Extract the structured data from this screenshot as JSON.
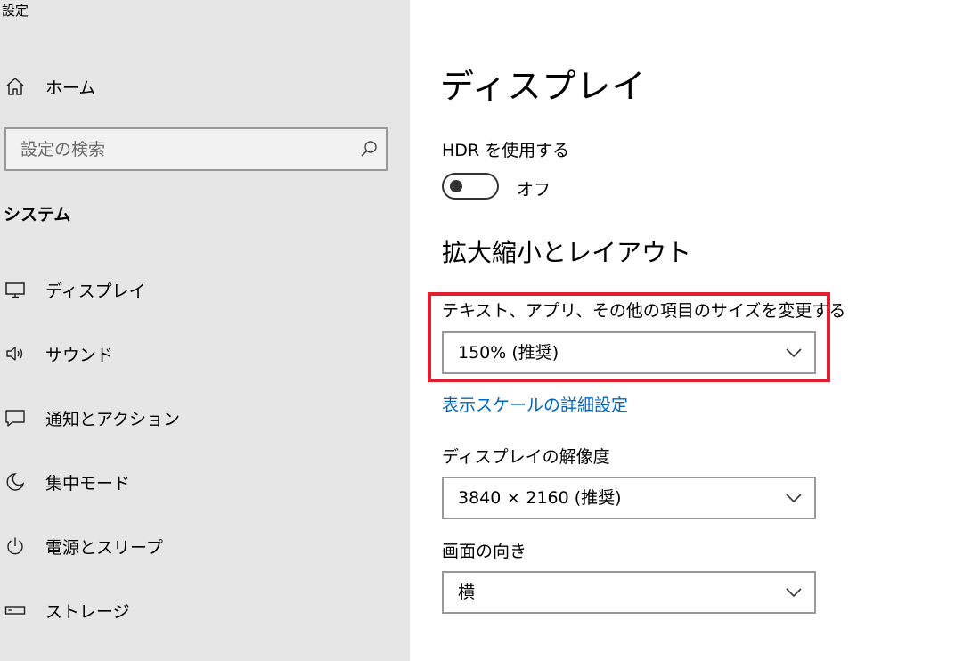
{
  "window": {
    "title": "設定"
  },
  "sidebar": {
    "home_label": "ホーム",
    "search": {
      "placeholder": "設定の検索"
    },
    "section": "システム",
    "items": [
      {
        "label": "ディスプレイ",
        "icon": "monitor-icon"
      },
      {
        "label": "サウンド",
        "icon": "speaker-icon"
      },
      {
        "label": "通知とアクション",
        "icon": "notification-icon"
      },
      {
        "label": "集中モード",
        "icon": "moon-icon"
      },
      {
        "label": "電源とスリープ",
        "icon": "power-icon"
      },
      {
        "label": "ストレージ",
        "icon": "storage-icon"
      }
    ]
  },
  "main": {
    "title": "ディスプレイ",
    "hdr": {
      "label": "HDR を使用する",
      "state": "オフ",
      "on": false
    },
    "scale_section": "拡大縮小とレイアウト",
    "scale": {
      "label": "テキスト、アプリ、その他の項目のサイズを変更する",
      "value": "150% (推奨)"
    },
    "advanced_link": "表示スケールの詳細設定",
    "resolution": {
      "label": "ディスプレイの解像度",
      "value": "3840 × 2160 (推奨)"
    },
    "orientation": {
      "label": "画面の向き",
      "value": "横"
    }
  },
  "colors": {
    "sidebar_bg": "#e6e6e6",
    "accent_link": "#0067c0",
    "highlight": "#e0202f"
  }
}
